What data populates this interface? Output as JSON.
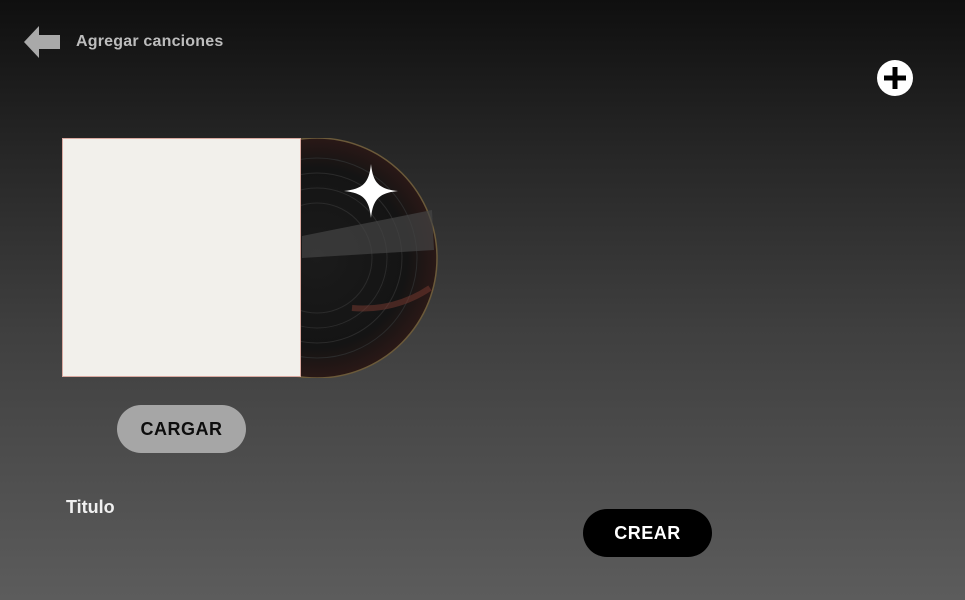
{
  "header": {
    "title": "Agregar canciones",
    "back_icon": "arrow-left-icon"
  },
  "actions": {
    "add_icon": "plus-circle-icon"
  },
  "cover": {
    "placeholder_color": "#f2f0eb",
    "vinyl_icon": "vinyl-record-icon",
    "sparkle_icon": "sparkle-icon"
  },
  "buttons": {
    "upload_label": "CARGAR",
    "create_label": "CREAR"
  },
  "form": {
    "title_label": "Titulo"
  }
}
